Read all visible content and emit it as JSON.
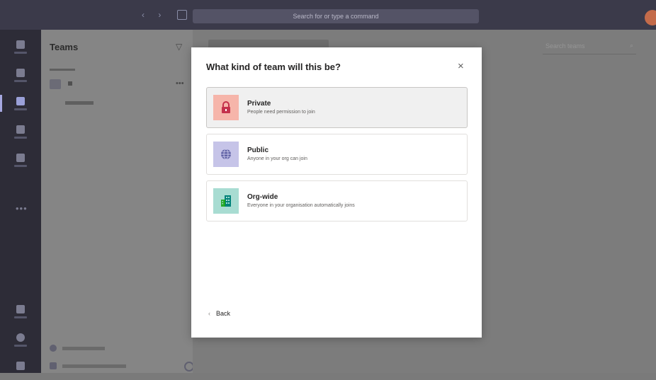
{
  "header": {
    "search_placeholder": "Search for or type a command"
  },
  "teams_panel": {
    "title": "Teams"
  },
  "main": {
    "search_teams_placeholder": "Search teams"
  },
  "dialog": {
    "title": "What kind of team will this be?",
    "close_glyph": "×",
    "options": [
      {
        "name": "Private",
        "description": "People need permission to join",
        "icon": "lock-icon",
        "color": "#f6b5aa",
        "selected": true
      },
      {
        "name": "Public",
        "description": "Anyone in your org can join",
        "icon": "globe-icon",
        "color": "#c6c4e8",
        "selected": false
      },
      {
        "name": "Org-wide",
        "description": "Everyone in your organisation automatically joins",
        "icon": "building-icon",
        "color": "#a8dcd2",
        "selected": false
      }
    ],
    "back_label": "Back"
  },
  "colors": {
    "topbar": "#3b3a4a",
    "rail": "#2d2c37",
    "accent": "#6264a7",
    "overlay": "#7c7c7c"
  }
}
